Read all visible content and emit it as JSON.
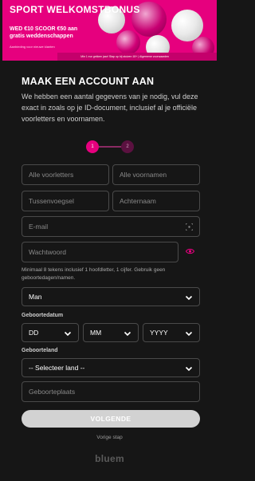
{
  "banner": {
    "title": "SPORT WELKOMSTBONUS",
    "offer": "WED €10 SCOOR €50 aan gratis weddenschappen",
    "small": "Aanbieding voor nieuwe klanten",
    "tc": "Min 1 eur gekken jaar! Stap op bij stuiven 18+ | Algemene voorwaarden"
  },
  "form": {
    "heading": "MAAK EEN ACCOUNT AAN",
    "intro": "We hebben een aantal gegevens van je nodig, vul deze exact in zoals op je ID-document, inclusief al je officiële voorletters en voornamen.",
    "steps": [
      "1",
      "2"
    ],
    "initials_placeholder": "Alle voorletters",
    "firstnames_placeholder": "Alle voornamen",
    "infix_placeholder": "Tussenvoegsel",
    "lastname_placeholder": "Achternaam",
    "email_placeholder": "E-mail",
    "password_placeholder": "Wachtwoord",
    "password_hint": "Minimaal 8 tekens inclusief 1 hoofdletter, 1 cijfer. Gebruik geen geboortedagen/namen.",
    "gender_value": "Man",
    "dob_label": "Geboortedatum",
    "dob_day": "DD",
    "dob_month": "MM",
    "dob_year": "YYYY",
    "country_label": "Geboorteland",
    "country_value": "-- Selecteer land --",
    "birthplace_placeholder": "Geboorteplaats",
    "next_label": "VOLGENDE",
    "prev_label": "Vorige stap"
  },
  "footer": {
    "logo": "bluem"
  },
  "colors": {
    "accent": "#e6007e",
    "background": "#161616",
    "button": "#d2d2d2"
  }
}
